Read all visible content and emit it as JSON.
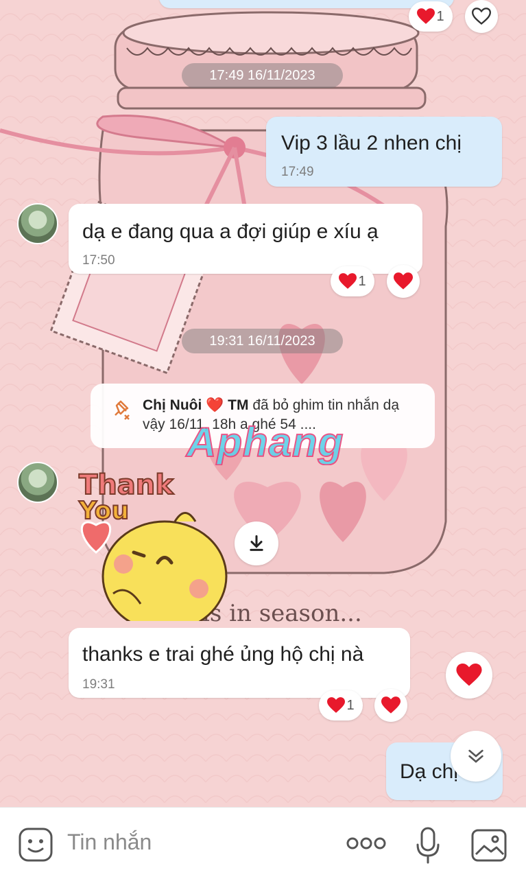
{
  "messages": {
    "top_timestamp": "17:49 16/11/2023",
    "out1": {
      "text": "Vip 3 lầu 2 nhen chị",
      "time": "17:49"
    },
    "in1": {
      "text": "dạ e đang qua a đợi giúp e xíu ạ",
      "time": "17:50",
      "reaction_count": "1"
    },
    "mid_timestamp": "19:31 16/11/2023",
    "system": {
      "name": "Chị Nuôi",
      "heart": "❤️",
      "name2": "TM",
      "text": " đã bỏ ghim tin nhắn dạ vậy 16/11, 18h a ghé 54 ...."
    },
    "sticker": {
      "line1": "Thank",
      "line2": "You"
    },
    "in2": {
      "text": "thanks e trai ghé ủng hộ chị nà",
      "time": "19:31",
      "reaction_count": "1"
    },
    "out2": {
      "text": "Dạ chị"
    },
    "top_reaction_count": "1"
  },
  "watermark": "Aphang",
  "background_text": "is in season...",
  "composer": {
    "placeholder": "Tin nhắn"
  },
  "colors": {
    "heart": "#e8192c",
    "out_bubble": "#d9ecfb",
    "background": "#f5cfcf"
  },
  "icons": [
    "emoji-icon",
    "more-icon",
    "microphone-icon",
    "image-icon",
    "download-icon",
    "scroll-down-icon",
    "unpin-icon",
    "heart-icon"
  ]
}
